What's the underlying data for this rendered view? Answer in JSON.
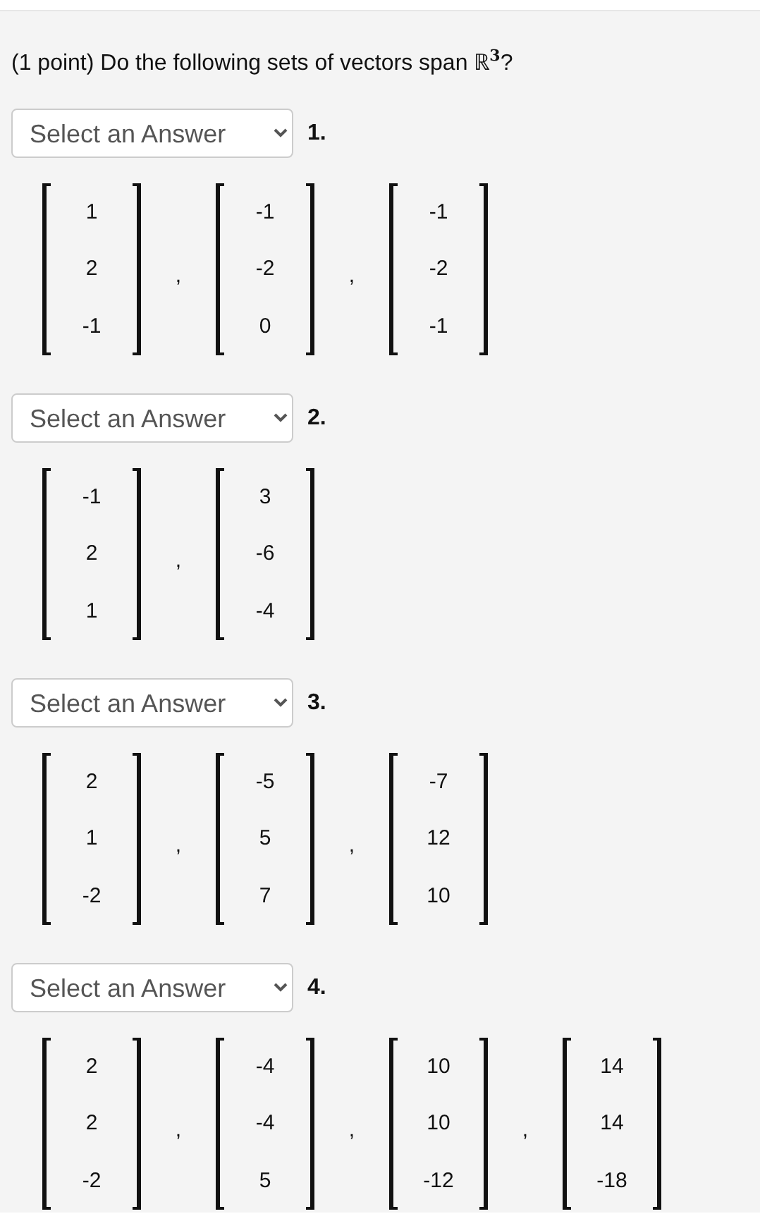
{
  "question": "(1 point) Do the following sets of vectors span ℝ$^{3}$?",
  "parts": [
    {
      "dropdown": "Select an Answer",
      "number": "1.",
      "vectors": [
        [
          "1",
          "2",
          "-1"
        ],
        [
          "-1",
          "-2",
          "0"
        ],
        [
          "-1",
          "-2",
          "-1"
        ]
      ],
      "separators": [
        ",",
        ","
      ]
    },
    {
      "dropdown": "Select an Answer",
      "number": "2.",
      "vectors": [
        [
          "-1",
          "2",
          "1"
        ],
        [
          "3",
          "-6",
          "-4"
        ]
      ],
      "separators": [
        ","
      ]
    },
    {
      "dropdown": "Select an Answer",
      "number": "3.",
      "vectors": [
        [
          "2",
          "1",
          "-2"
        ],
        [
          "-5",
          "5",
          "7"
        ],
        [
          "-7",
          "12",
          "10"
        ]
      ],
      "separators": [
        ",",
        ","
      ]
    },
    {
      "dropdown": "Select an Answer",
      "number": "4.",
      "vectors": [
        [
          "2",
          "2",
          "-2"
        ],
        [
          "-4",
          "-4",
          "5"
        ],
        [
          "10",
          "10",
          "-12"
        ],
        [
          "14",
          "14",
          "-18"
        ]
      ],
      "separators": [
        ",",
        ",",
        ","
      ]
    }
  ]
}
